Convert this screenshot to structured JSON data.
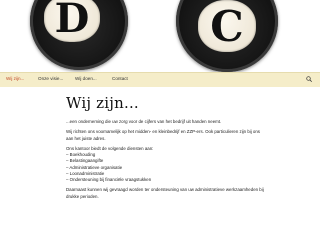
{
  "banner": {
    "key_left": "D",
    "key_right": "C"
  },
  "nav": {
    "items": [
      {
        "label": "Wij zijn..."
      },
      {
        "label": "Onze visie..."
      },
      {
        "label": "Wij doen..."
      },
      {
        "label": "Contact"
      }
    ],
    "active_color": "#c24a29",
    "bar_color": "#f5edc9",
    "search_icon": "search-icon"
  },
  "main": {
    "title": "Wij zijn...",
    "intro": "...een onderneming die uw zorg voor de cijfers van het bedrijf uit handen neemt.",
    "audience": "Wij richten ons voornamelijk op het midden- en kleinbedrijf en ZZP-ers. Ook particulieren zijn bij ons aan het juiste adres.",
    "services_intro": "Ons kantoor biedt de volgende diensten aan:",
    "services": [
      "– Boekhouding",
      "– Belastingaangifte",
      "– Administratieve organisatie",
      "– Loonadministratie",
      "– Ondersteuning bij financiële vraagstukken"
    ],
    "closing": "Daarnaast kunnen wij gevraagd worden ter ondersteuning van uw administratieve werkzaamheden bij drukke perioden."
  }
}
